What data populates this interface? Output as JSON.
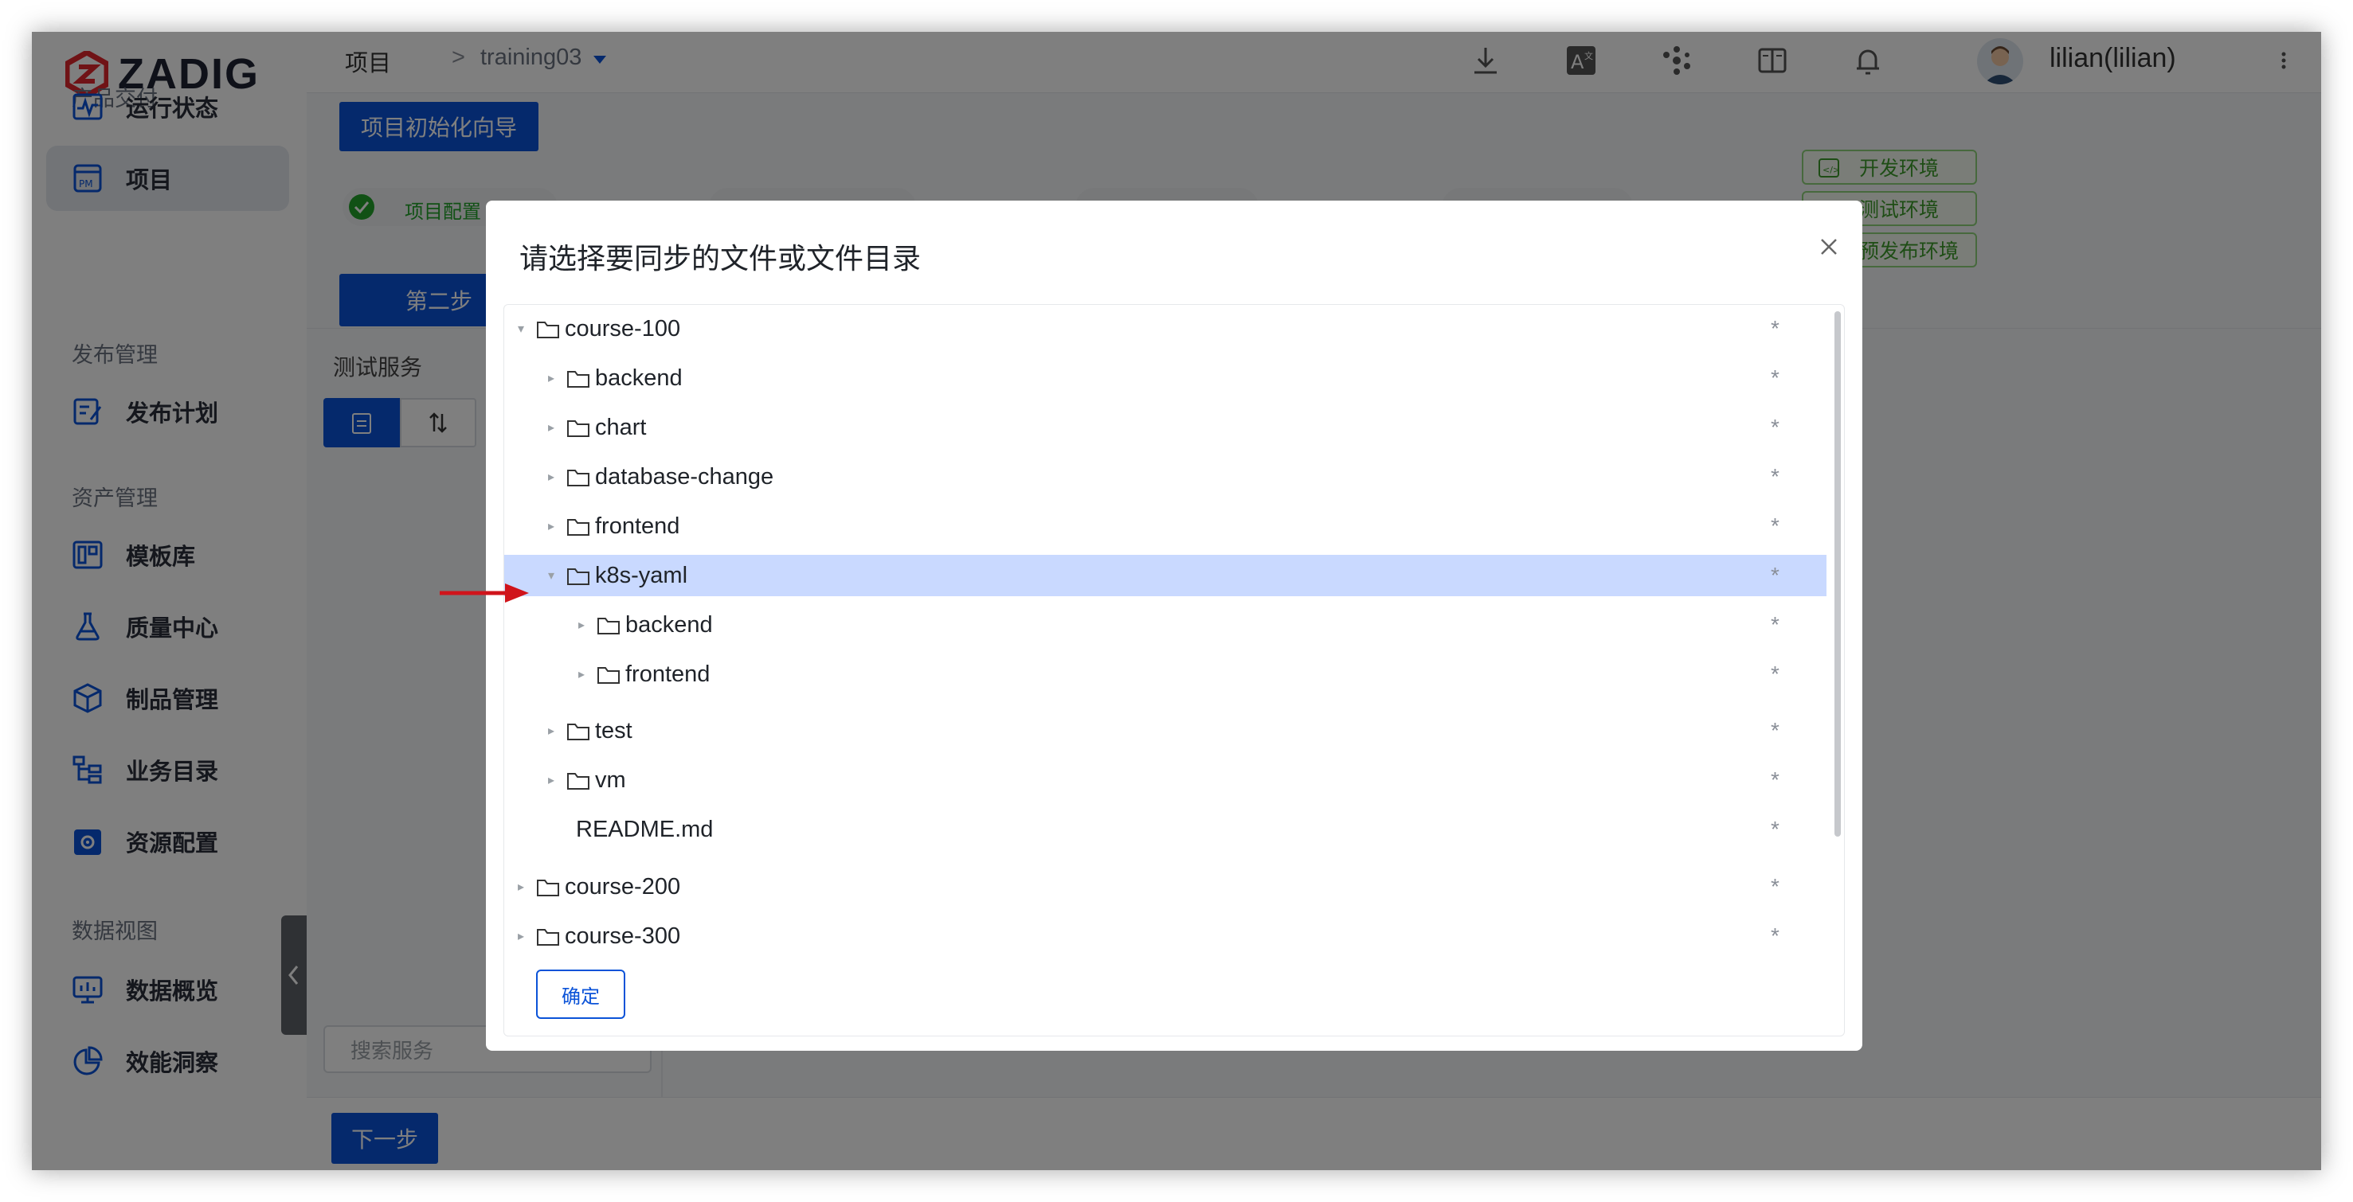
{
  "brand": {
    "name": "ZADIG"
  },
  "sidebar": {
    "sections": [
      {
        "title": "产品交付",
        "items": [
          {
            "label": "运行状态",
            "icon": "activity-monitor-icon"
          },
          {
            "label": "项目",
            "icon": "project-pm-icon",
            "active": true
          }
        ]
      },
      {
        "title": "发布管理",
        "items": [
          {
            "label": "发布计划",
            "icon": "release-plan-icon"
          }
        ]
      },
      {
        "title": "资产管理",
        "items": [
          {
            "label": "模板库",
            "icon": "template-library-icon"
          },
          {
            "label": "质量中心",
            "icon": "flask-icon"
          },
          {
            "label": "制品管理",
            "icon": "artifact-box-icon"
          },
          {
            "label": "业务目录",
            "icon": "business-catalog-icon"
          },
          {
            "label": "资源配置",
            "icon": "resource-settings-icon"
          }
        ]
      },
      {
        "title": "数据视图",
        "items": [
          {
            "label": "数据概览",
            "icon": "data-overview-icon"
          },
          {
            "label": "效能洞察",
            "icon": "pie-chart-icon"
          }
        ]
      }
    ]
  },
  "header": {
    "breadcrumb_root": "项目",
    "breadcrumb_sep": ">",
    "breadcrumb_project": "training03",
    "username": "lilian(lilian)",
    "icons": [
      "download-icon",
      "translate-icon",
      "plugin-dots-icon",
      "docs-book-icon",
      "bell-icon",
      "more-vertical-icon"
    ]
  },
  "background": {
    "wizard_button": "项目初始化向导",
    "step1_label": "项目配置",
    "step2_button": "第二步",
    "env_tags": [
      "开发环境",
      "测试环境",
      "预发布环境"
    ],
    "panel_title": "测试服务",
    "search_placeholder": "搜索服务",
    "next_button": "下一步"
  },
  "modal": {
    "title": "请选择要同步的文件或文件目录",
    "confirm_label": "确定",
    "tree": [
      {
        "name": "course-100",
        "depth": 0,
        "type": "folder",
        "expanded": true,
        "star": "*"
      },
      {
        "name": "backend",
        "depth": 1,
        "type": "folder",
        "expanded": false,
        "star": "*"
      },
      {
        "name": "chart",
        "depth": 1,
        "type": "folder",
        "expanded": false,
        "star": "*"
      },
      {
        "name": "database-change",
        "depth": 1,
        "type": "folder",
        "expanded": false,
        "star": "*"
      },
      {
        "name": "frontend",
        "depth": 1,
        "type": "folder",
        "expanded": false,
        "star": "*"
      },
      {
        "name": "k8s-yaml",
        "depth": 1,
        "type": "folder",
        "expanded": true,
        "selected": true,
        "star": "*"
      },
      {
        "name": "backend",
        "depth": 2,
        "type": "folder",
        "expanded": false,
        "star": "*"
      },
      {
        "name": "frontend",
        "depth": 2,
        "type": "folder",
        "expanded": false,
        "star": "*"
      },
      {
        "name": "test",
        "depth": 1,
        "type": "folder",
        "expanded": false,
        "star": "*"
      },
      {
        "name": "vm",
        "depth": 1,
        "type": "folder",
        "expanded": false,
        "star": "*"
      },
      {
        "name": "README.md",
        "depth": 1,
        "type": "file",
        "star": "*"
      },
      {
        "name": "course-200",
        "depth": 0,
        "type": "folder",
        "expanded": false,
        "star": "*"
      },
      {
        "name": "course-300",
        "depth": 0,
        "type": "folder",
        "expanded": false,
        "star": "*"
      }
    ]
  },
  "colors": {
    "primary": "#0b53d8",
    "selected_row": "#c9d9ff",
    "annotation_arrow": "#d0141b",
    "env_tag_green": "#3c9b2a"
  }
}
